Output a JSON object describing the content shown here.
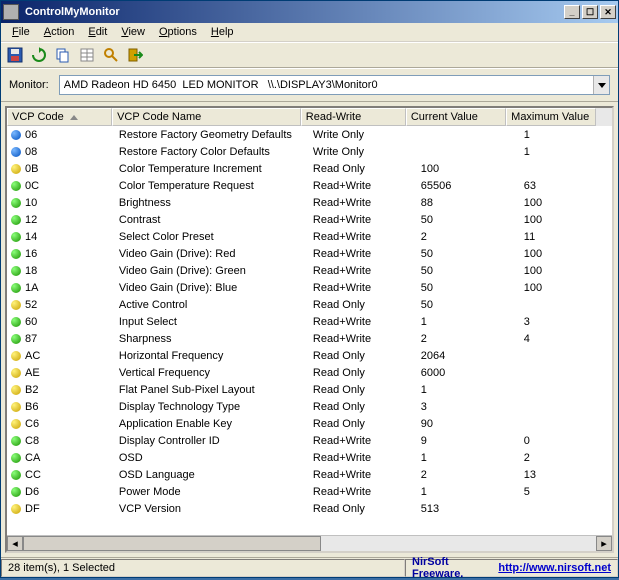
{
  "window": {
    "title": "ControlMyMonitor"
  },
  "menu": {
    "file": "File",
    "action": "Action",
    "edit": "Edit",
    "view": "View",
    "options": "Options",
    "help": "Help"
  },
  "monitor": {
    "label": "Monitor:",
    "value": "AMD Radeon HD 6450  LED MONITOR   \\\\.\\DISPLAY3\\Monitor0"
  },
  "columns": {
    "code": "VCP Code",
    "name": "VCP Code Name",
    "rw": "Read-Write",
    "cur": "Current Value",
    "max": "Maximum Value"
  },
  "rows": [
    {
      "dot": "blue",
      "code": "06",
      "name": "Restore Factory Geometry Defaults",
      "rw": "Write Only",
      "cur": "",
      "max": "1"
    },
    {
      "dot": "blue",
      "code": "08",
      "name": "Restore Factory Color Defaults",
      "rw": "Write Only",
      "cur": "",
      "max": "1"
    },
    {
      "dot": "yellow",
      "code": "0B",
      "name": "Color Temperature Increment",
      "rw": "Read Only",
      "cur": "100",
      "max": ""
    },
    {
      "dot": "green",
      "code": "0C",
      "name": "Color Temperature Request",
      "rw": "Read+Write",
      "cur": "65506",
      "max": "63"
    },
    {
      "dot": "green",
      "code": "10",
      "name": "Brightness",
      "rw": "Read+Write",
      "cur": "88",
      "max": "100"
    },
    {
      "dot": "green",
      "code": "12",
      "name": "Contrast",
      "rw": "Read+Write",
      "cur": "50",
      "max": "100"
    },
    {
      "dot": "green",
      "code": "14",
      "name": "Select Color Preset",
      "rw": "Read+Write",
      "cur": "2",
      "max": "11"
    },
    {
      "dot": "green",
      "code": "16",
      "name": "Video Gain (Drive): Red",
      "rw": "Read+Write",
      "cur": "50",
      "max": "100"
    },
    {
      "dot": "green",
      "code": "18",
      "name": "Video Gain (Drive): Green",
      "rw": "Read+Write",
      "cur": "50",
      "max": "100"
    },
    {
      "dot": "green",
      "code": "1A",
      "name": "Video Gain (Drive): Blue",
      "rw": "Read+Write",
      "cur": "50",
      "max": "100"
    },
    {
      "dot": "yellow",
      "code": "52",
      "name": "Active Control",
      "rw": "Read Only",
      "cur": "50",
      "max": ""
    },
    {
      "dot": "green",
      "code": "60",
      "name": "Input Select",
      "rw": "Read+Write",
      "cur": "1",
      "max": "3"
    },
    {
      "dot": "green",
      "code": "87",
      "name": "Sharpness",
      "rw": "Read+Write",
      "cur": "2",
      "max": "4"
    },
    {
      "dot": "yellow",
      "code": "AC",
      "name": "Horizontal Frequency",
      "rw": "Read Only",
      "cur": "2064",
      "max": ""
    },
    {
      "dot": "yellow",
      "code": "AE",
      "name": "Vertical Frequency",
      "rw": "Read Only",
      "cur": "6000",
      "max": ""
    },
    {
      "dot": "yellow",
      "code": "B2",
      "name": "Flat Panel Sub-Pixel Layout",
      "rw": "Read Only",
      "cur": "1",
      "max": ""
    },
    {
      "dot": "yellow",
      "code": "B6",
      "name": "Display Technology Type",
      "rw": "Read Only",
      "cur": "3",
      "max": ""
    },
    {
      "dot": "yellow",
      "code": "C6",
      "name": "Application Enable Key",
      "rw": "Read Only",
      "cur": "90",
      "max": ""
    },
    {
      "dot": "green",
      "code": "C8",
      "name": "Display Controller ID",
      "rw": "Read+Write",
      "cur": "9",
      "max": "0"
    },
    {
      "dot": "green",
      "code": "CA",
      "name": "OSD",
      "rw": "Read+Write",
      "cur": "1",
      "max": "2"
    },
    {
      "dot": "green",
      "code": "CC",
      "name": "OSD Language",
      "rw": "Read+Write",
      "cur": "2",
      "max": "13"
    },
    {
      "dot": "green",
      "code": "D6",
      "name": "Power Mode",
      "rw": "Read+Write",
      "cur": "1",
      "max": "5"
    },
    {
      "dot": "yellow",
      "code": "DF",
      "name": "VCP Version",
      "rw": "Read Only",
      "cur": "513",
      "max": ""
    }
  ],
  "status": {
    "count": "28 item(s), 1 Selected",
    "credit": "NirSoft Freeware.  ",
    "url": "http://www.nirsoft.net"
  }
}
